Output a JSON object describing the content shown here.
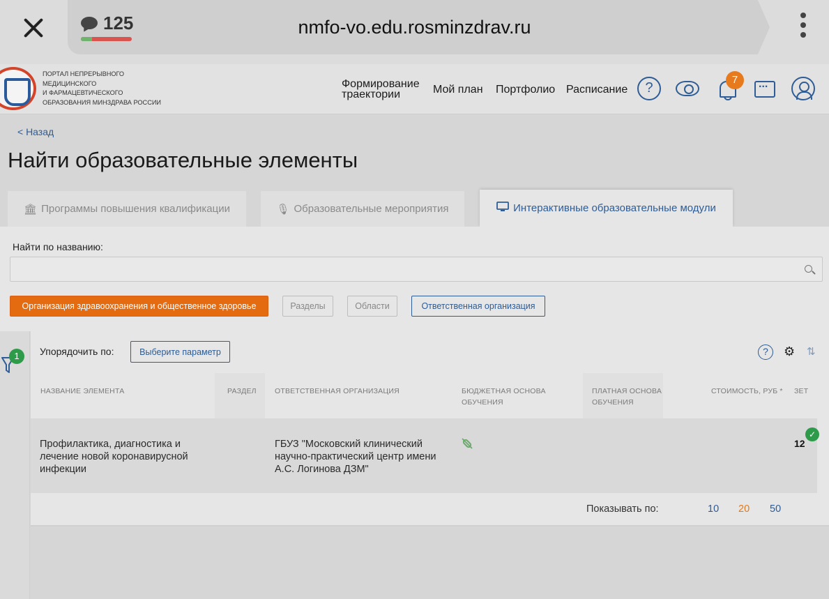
{
  "browser": {
    "comment_count": "125",
    "comment_ratio_positive": 0.22,
    "url": "nmfo-vo.edu.rosminzdrav.ru"
  },
  "header": {
    "logo_lines": [
      "Портал непрерывного",
      "медицинского",
      "и фармацевтического",
      "образования Минздрава России"
    ],
    "nav": [
      "Формирование траектории",
      "Мой план",
      "Портфолио",
      "Расписание"
    ],
    "notifications": "7",
    "help_symbol": "?"
  },
  "page": {
    "back": "< Назад",
    "title": "Найти образовательные элементы"
  },
  "tabs": [
    {
      "label": "Программы повышения квалификации",
      "icon": "bank-icon",
      "active": false
    },
    {
      "label": "Образовательные мероприятия",
      "icon": "microphone-icon",
      "active": false
    },
    {
      "label": "Интерактивные образовательные модули",
      "icon": "monitor-icon",
      "active": true
    }
  ],
  "search": {
    "label": "Найти по названию:",
    "value": "",
    "placeholder": ""
  },
  "filters": [
    "Организация здравоохранения и общественное здоровье",
    "Разделы",
    "Области",
    "Ответственная организация"
  ],
  "results": {
    "filter_count": "1",
    "sort_label": "Упорядочить по:",
    "sort_button": "Выберите параметр",
    "help_symbol": "?",
    "columns": [
      "Название элемента",
      "Раздел",
      "Ответственная организация",
      "Бюджетная основа обучения",
      "Платная основа обучения",
      "Стоимость, руб *",
      "ЗЕТ"
    ],
    "rows": [
      {
        "name": "Профилактика, диагностика и лечение новой коронавирусной инфекции",
        "section": "",
        "organization": "ГБУЗ \"Московский клинический научно-практический центр имени А.С. Логинова ДЗМ\"",
        "budget": "budget-icon",
        "paid": "",
        "cost": "",
        "zet": "12"
      }
    ],
    "pager_label": "Показывать по:",
    "pager_options": [
      "10",
      "20",
      "50"
    ],
    "pager_active": "20"
  },
  "colors": {
    "accent": "#2d5c96",
    "primary_button": "#e56b10",
    "badge_orange": "#e87a1e",
    "badge_green": "#2e9b4a"
  }
}
